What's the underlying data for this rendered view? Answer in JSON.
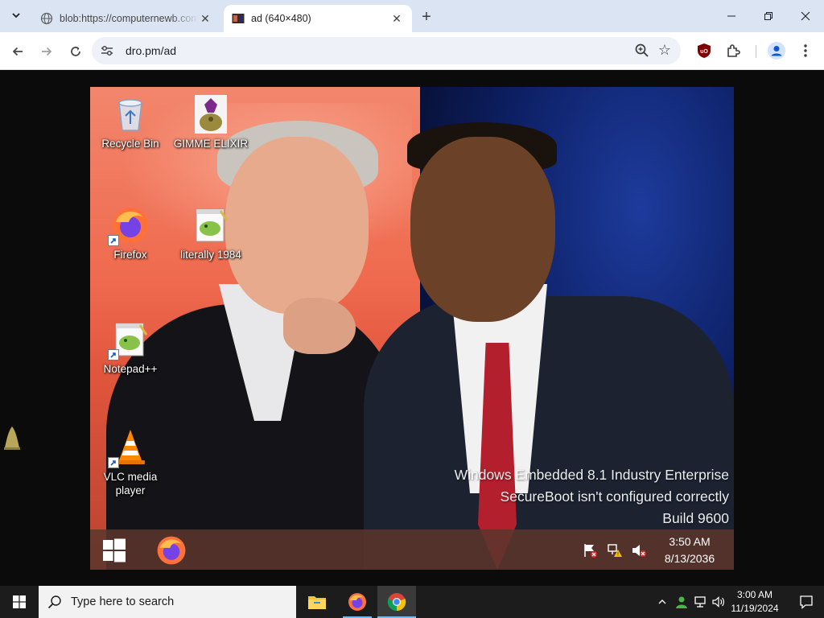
{
  "browser": {
    "tabs": [
      {
        "title": "blob:https://computernewb.com",
        "active": false
      },
      {
        "title": "ad (640×480)",
        "active": true
      }
    ],
    "url": "dro.pm/ad"
  },
  "vm_desktop": {
    "icons": [
      {
        "label": "Recycle Bin",
        "icon": "recycle-bin-icon"
      },
      {
        "label": "GIMME ELIXIR",
        "icon": "elixir-bag-icon"
      },
      {
        "label": "Firefox",
        "icon": "firefox-icon"
      },
      {
        "label": "literally 1984",
        "icon": "notepad-plus-icon"
      },
      {
        "label": "Notepad++",
        "icon": "notepad-plus-icon"
      },
      {
        "label": "VLC media player",
        "icon": "vlc-icon"
      }
    ],
    "watermark": {
      "line1": "Windows Embedded 8.1 Industry Enterprise",
      "line2": "SecureBoot isn't configured correctly",
      "line3": "Build 9600"
    },
    "taskbar": {
      "time": "3:50 AM",
      "date": "8/13/2036"
    }
  },
  "host_taskbar": {
    "search_placeholder": "Type here to search",
    "apps": [
      "file-explorer",
      "firefox",
      "chrome"
    ],
    "time": "3:00 AM",
    "date": "11/19/2024"
  },
  "colors": {
    "tabstrip": "#dbe4f3",
    "taskbar": "#1c1c1c",
    "accent": "#76b9ed"
  }
}
